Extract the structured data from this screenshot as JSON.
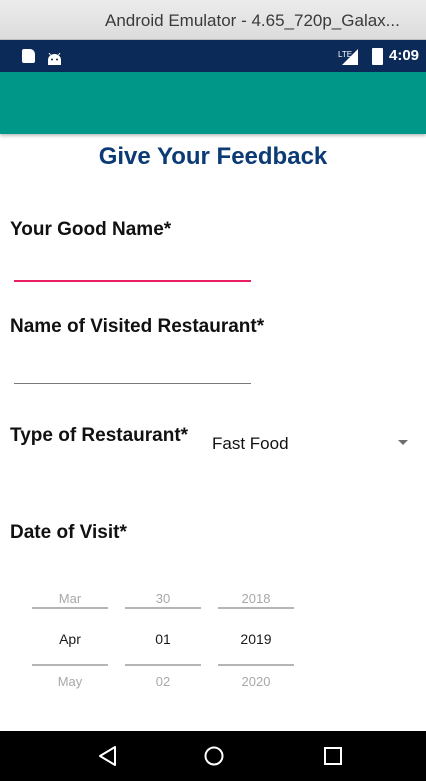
{
  "window": {
    "title": "Android Emulator - 4.65_720p_Galax..."
  },
  "status_bar": {
    "network_label": "LTE",
    "time": "4:09",
    "background_color": "#0b2a57",
    "icons": [
      "sd-card-icon",
      "android-icon",
      "signal-icon",
      "battery-icon"
    ]
  },
  "app_bar": {
    "color": "#009688"
  },
  "form": {
    "title": "Give Your Feedback",
    "name_label": "Your Good Name*",
    "name_value": "",
    "restaurant_label": "Name of Visited Restaurant*",
    "restaurant_value": "",
    "type_label": "Type of Restaurant*",
    "type_value": "Fast Food",
    "date_label": "Date of Visit*",
    "accent_focused_color": "#e91e63",
    "title_color": "#0b3a75"
  },
  "date_picker": {
    "month": {
      "prev": "Mar",
      "selected": "Apr",
      "next": "May"
    },
    "day": {
      "prev": "30",
      "selected": "01",
      "next": "02"
    },
    "year": {
      "prev": "2018",
      "selected": "2019",
      "next": "2020"
    }
  },
  "nav_bar": {
    "buttons": [
      "back-icon",
      "home-icon",
      "recents-icon"
    ]
  }
}
